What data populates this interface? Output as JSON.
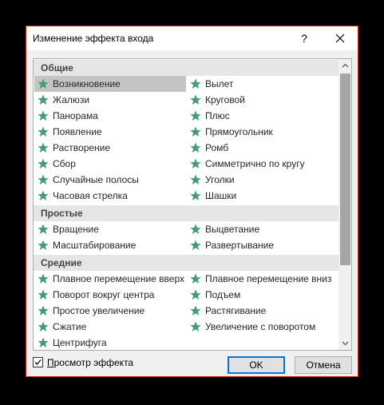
{
  "dialog": {
    "title": "Изменение эффекта входа",
    "help_label": "?",
    "ok_label": "OK",
    "cancel_label": "Отмена",
    "preview_prefix": "П",
    "preview_rest": "росмотр эффекта",
    "preview_checked": true
  },
  "groups": [
    {
      "header": "Общие",
      "col1": [
        "Возникновение",
        "Жалюзи",
        "Панорама",
        "Появление",
        "Растворение",
        "Сбор",
        "Случайные полосы",
        "Часовая стрелка"
      ],
      "col2": [
        "Вылет",
        "Круговой",
        "Плюс",
        "Прямоугольник",
        "Ромб",
        "Симметрично по кругу",
        "Уголки",
        "Шашки"
      ]
    },
    {
      "header": "Простые",
      "col1": [
        "Вращение",
        "Масштабирование"
      ],
      "col2": [
        "Выцветание",
        "Развертывание"
      ]
    },
    {
      "header": "Средние",
      "col1": [
        "Плавное перемещение вверх",
        "Поворот вокруг центра",
        "Простое увеличение",
        "Сжатие",
        "Центрифуга"
      ],
      "col2": [
        "Плавное перемещение вниз",
        "Подъем",
        "Растягивание",
        "Увеличение с поворотом"
      ]
    }
  ],
  "selected_item": "Возникновение",
  "colors": {
    "star": "#4a9a78",
    "selected_bg": "#c4c4c4",
    "group_bg": "#e6e6e6",
    "accent": "#0078d7",
    "window_border": "#c42b1c"
  },
  "icons": {
    "effect": "star-icon",
    "close": "close-icon",
    "scroll_up": "chevron-up-icon",
    "scroll_down": "chevron-down-icon",
    "checkbox": "checkmark-icon"
  }
}
